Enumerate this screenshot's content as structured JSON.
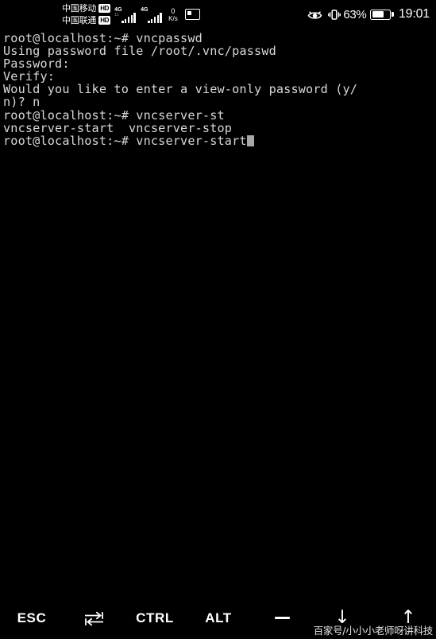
{
  "status_bar": {
    "carriers": [
      {
        "name": "中国移动",
        "badge": "HD",
        "network": "4G",
        "sub": "11"
      },
      {
        "name": "中国联通",
        "badge": "HD",
        "network": "4G",
        "sub": ""
      }
    ],
    "data_speed_value": "0",
    "data_speed_unit": "K/s",
    "screen_record_icon": "screen-record-icon",
    "eye_comfort_icon": "eye-comfort-icon",
    "vibrate_icon": "vibrate-icon",
    "battery_percent": "63%",
    "battery_level": 63,
    "time": "19:01"
  },
  "terminal": {
    "lines": [
      "root@localhost:~# vncpasswd",
      "Using password file /root/.vnc/passwd",
      "Password:",
      "Verify:",
      "Would you like to enter a view-only password (y/",
      "n)? n",
      "root@localhost:~# vncserver-st",
      "vncserver-start  vncserver-stop",
      "root@localhost:~# vncserver-start"
    ],
    "cursor_visible": true,
    "foreground_color": "#d8d8d8",
    "background_color": "#000000",
    "cursor_color": "#a8a8a8"
  },
  "toolbar": {
    "esc_label": "ESC",
    "tab_icon": "tab-key-icon",
    "ctrl_label": "CTRL",
    "alt_label": "ALT",
    "minus_icon": "minus-key-icon",
    "arrow_down_icon": "↓",
    "arrow_up_icon": "↑"
  },
  "watermark": {
    "text": "百家号/小小小老师呀讲科技"
  }
}
